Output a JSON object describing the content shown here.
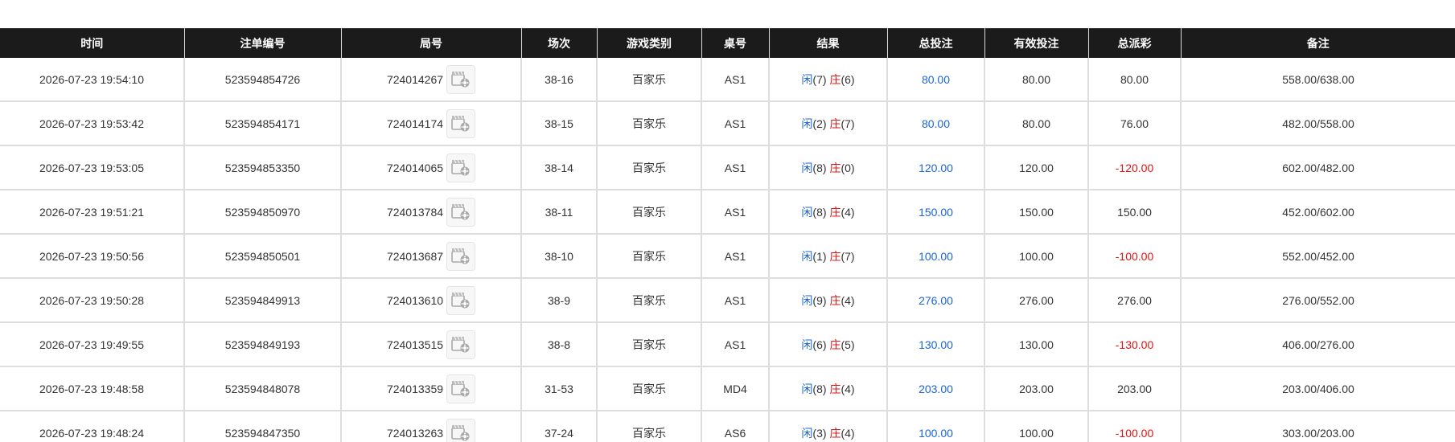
{
  "columns": [
    "时间",
    "注单编号",
    "局号",
    "场次",
    "游戏类别",
    "桌号",
    "结果",
    "总投注",
    "有效投注",
    "总派彩",
    "备注"
  ],
  "colors": {
    "header_bg": "#1b1b1b",
    "positive_bet": "#1a66d6",
    "negative_payout": "#e01313",
    "banker_label": "#e01313",
    "player_label": "#1a66d6"
  },
  "icons": {
    "replay": "video-replay-icon"
  },
  "rows": [
    {
      "time": "2026-07-23 19:54:10",
      "order_no": "523594854726",
      "round_no": "724014267",
      "session": "38-16",
      "game": "百家乐",
      "table": "AS1",
      "player_label": "闲",
      "player_score": "(7)",
      "banker_label": "庄",
      "banker_score": "(6)",
      "total_bet": "80.00",
      "valid_bet": "80.00",
      "payout": "80.00",
      "payout_negative": false,
      "note": "558.00/638.00"
    },
    {
      "time": "2026-07-23 19:53:42",
      "order_no": "523594854171",
      "round_no": "724014174",
      "session": "38-15",
      "game": "百家乐",
      "table": "AS1",
      "player_label": "闲",
      "player_score": "(2)",
      "banker_label": "庄",
      "banker_score": "(7)",
      "total_bet": "80.00",
      "valid_bet": "80.00",
      "payout": "76.00",
      "payout_negative": false,
      "note": "482.00/558.00"
    },
    {
      "time": "2026-07-23 19:53:05",
      "order_no": "523594853350",
      "round_no": "724014065",
      "session": "38-14",
      "game": "百家乐",
      "table": "AS1",
      "player_label": "闲",
      "player_score": "(8)",
      "banker_label": "庄",
      "banker_score": "(0)",
      "total_bet": "120.00",
      "valid_bet": "120.00",
      "payout": "-120.00",
      "payout_negative": true,
      "note": "602.00/482.00"
    },
    {
      "time": "2026-07-23 19:51:21",
      "order_no": "523594850970",
      "round_no": "724013784",
      "session": "38-11",
      "game": "百家乐",
      "table": "AS1",
      "player_label": "闲",
      "player_score": "(8)",
      "banker_label": "庄",
      "banker_score": "(4)",
      "total_bet": "150.00",
      "valid_bet": "150.00",
      "payout": "150.00",
      "payout_negative": false,
      "note": "452.00/602.00"
    },
    {
      "time": "2026-07-23 19:50:56",
      "order_no": "523594850501",
      "round_no": "724013687",
      "session": "38-10",
      "game": "百家乐",
      "table": "AS1",
      "player_label": "闲",
      "player_score": "(1)",
      "banker_label": "庄",
      "banker_score": "(7)",
      "total_bet": "100.00",
      "valid_bet": "100.00",
      "payout": "-100.00",
      "payout_negative": true,
      "note": "552.00/452.00"
    },
    {
      "time": "2026-07-23 19:50:28",
      "order_no": "523594849913",
      "round_no": "724013610",
      "session": "38-9",
      "game": "百家乐",
      "table": "AS1",
      "player_label": "闲",
      "player_score": "(9)",
      "banker_label": "庄",
      "banker_score": "(4)",
      "total_bet": "276.00",
      "valid_bet": "276.00",
      "payout": "276.00",
      "payout_negative": false,
      "note": "276.00/552.00"
    },
    {
      "time": "2026-07-23 19:49:55",
      "order_no": "523594849193",
      "round_no": "724013515",
      "session": "38-8",
      "game": "百家乐",
      "table": "AS1",
      "player_label": "闲",
      "player_score": "(6)",
      "banker_label": "庄",
      "banker_score": "(5)",
      "total_bet": "130.00",
      "valid_bet": "130.00",
      "payout": "-130.00",
      "payout_negative": true,
      "note": "406.00/276.00"
    },
    {
      "time": "2026-07-23 19:48:58",
      "order_no": "523594848078",
      "round_no": "724013359",
      "session": "31-53",
      "game": "百家乐",
      "table": "MD4",
      "player_label": "闲",
      "player_score": "(8)",
      "banker_label": "庄",
      "banker_score": "(4)",
      "total_bet": "203.00",
      "valid_bet": "203.00",
      "payout": "203.00",
      "payout_negative": false,
      "note": "203.00/406.00"
    },
    {
      "time": "2026-07-23 19:48:24",
      "order_no": "523594847350",
      "round_no": "724013263",
      "session": "37-24",
      "game": "百家乐",
      "table": "AS6",
      "player_label": "闲",
      "player_score": "(3)",
      "banker_label": "庄",
      "banker_score": "(4)",
      "total_bet": "100.00",
      "valid_bet": "100.00",
      "payout": "-100.00",
      "payout_negative": true,
      "note": "303.00/203.00"
    }
  ]
}
